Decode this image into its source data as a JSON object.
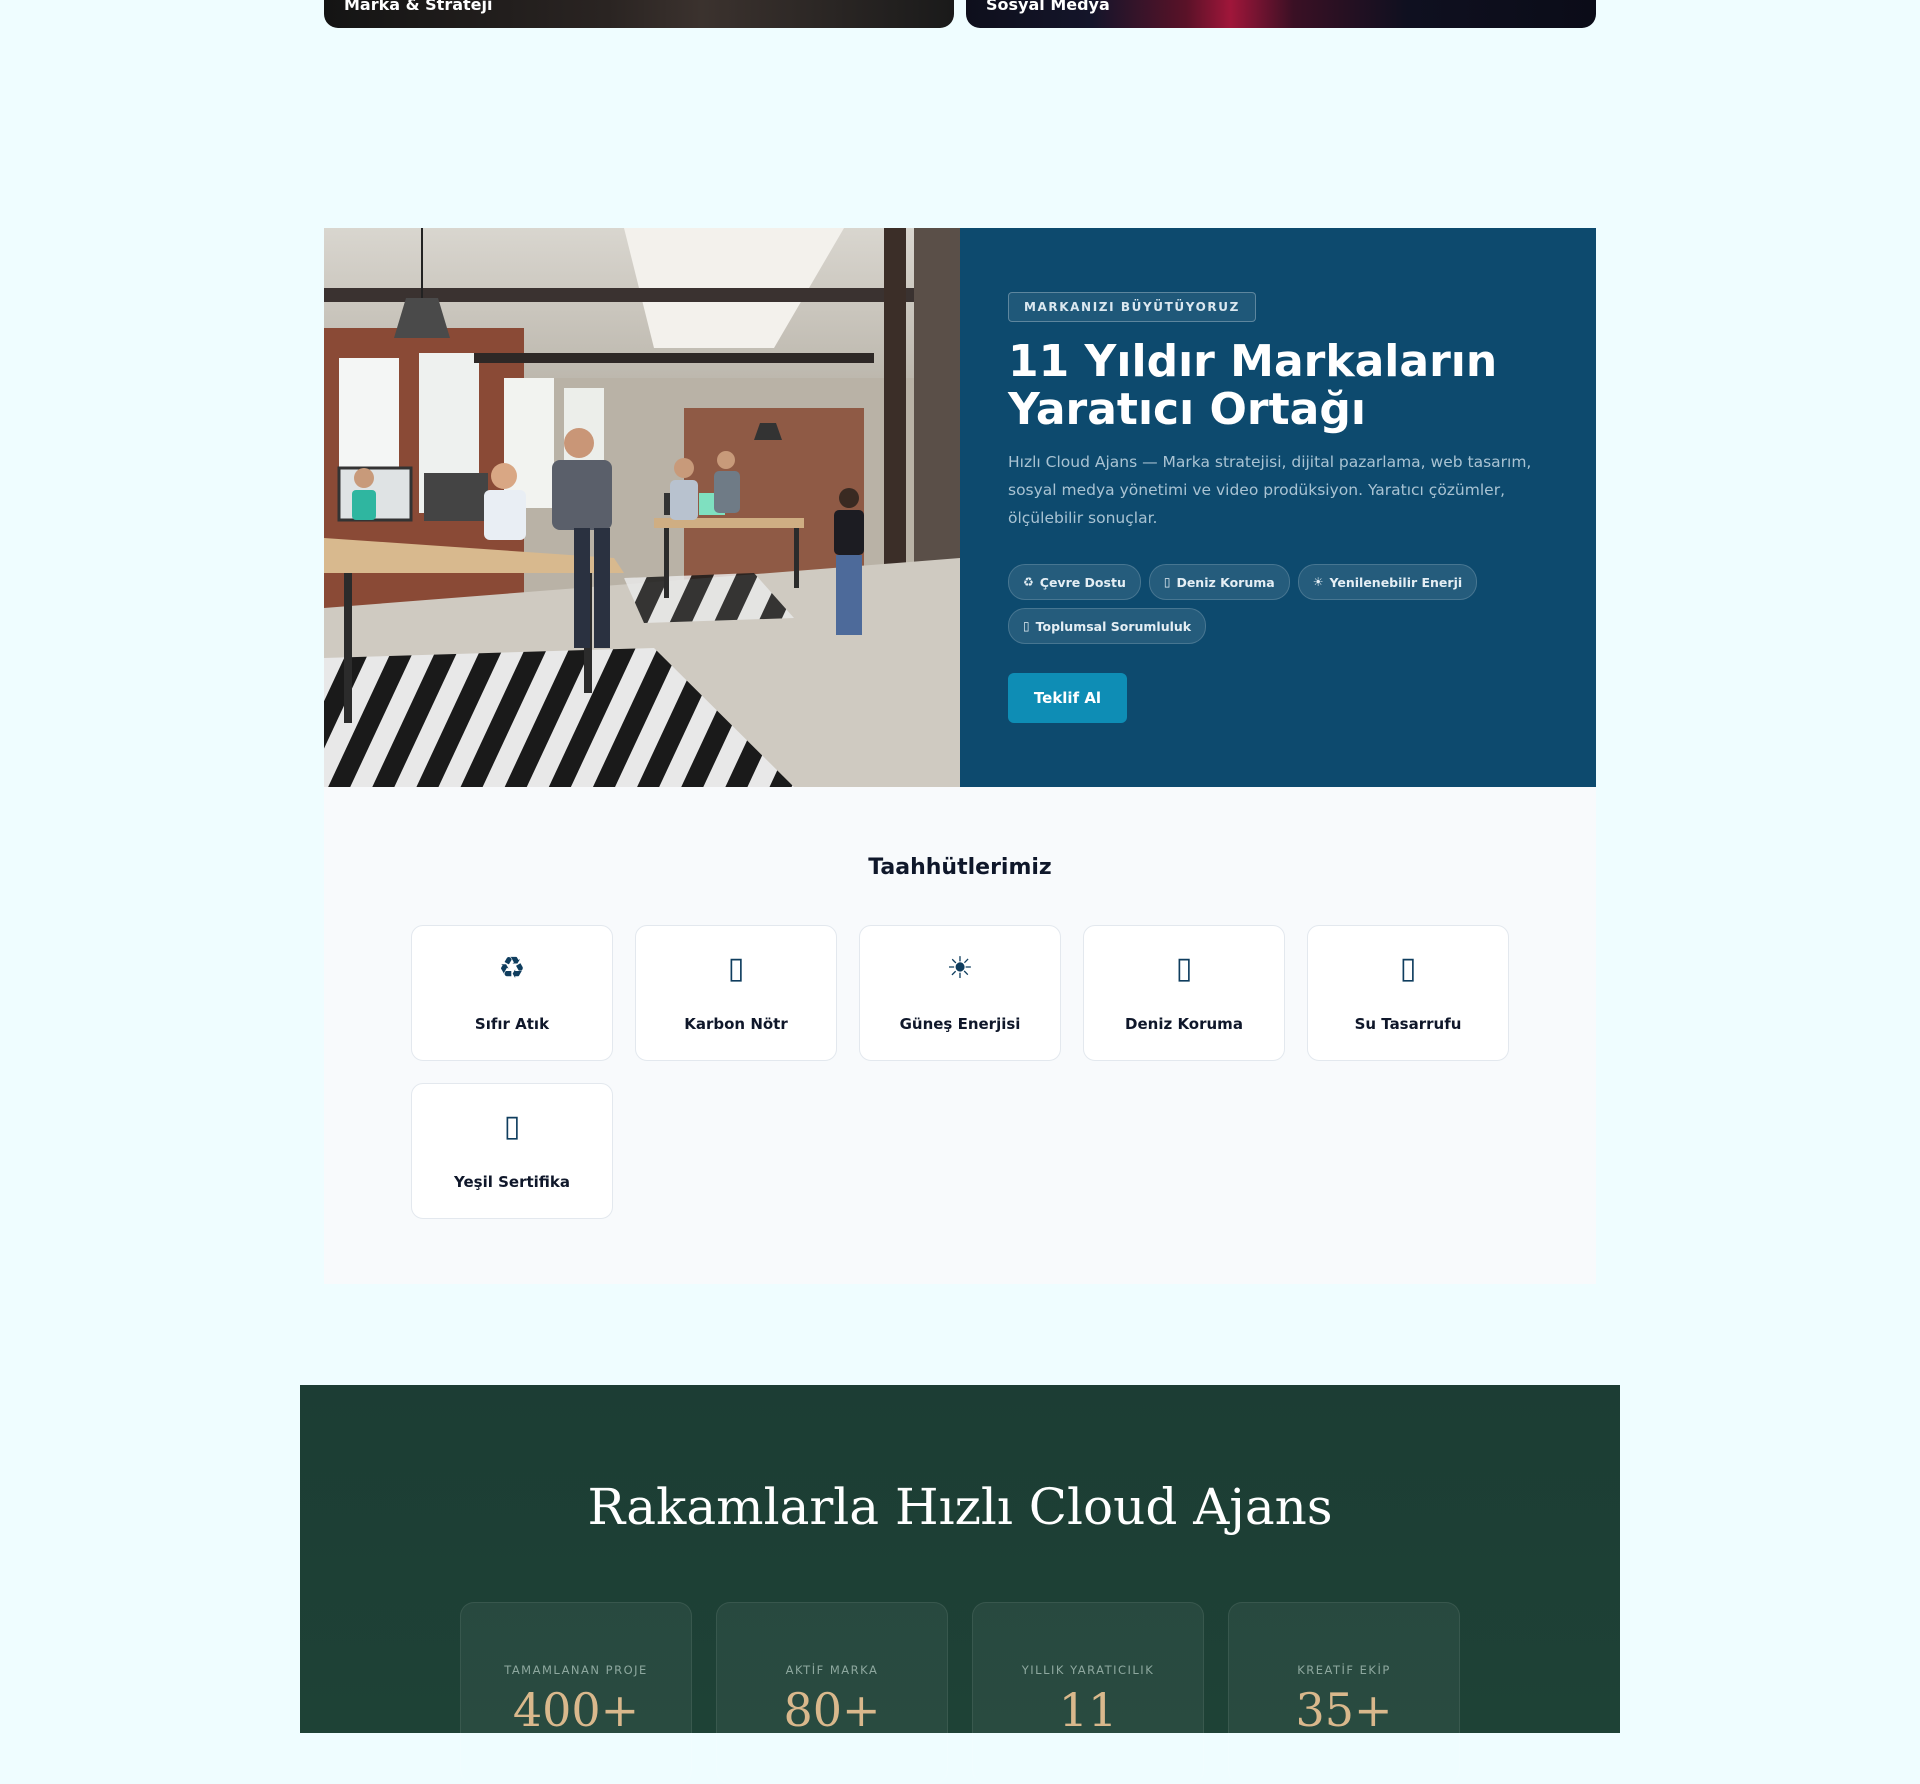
{
  "top_cards": {
    "left_label": "Marka & Strateji",
    "right_label": "Sosyal Medya"
  },
  "hero": {
    "eyebrow": "MARKANIZI BÜYÜTÜYORUZ",
    "title": "11 Yıldır Markaların Yaratıcı Ortağı",
    "description": "Hızlı Cloud Ajans — Marka stratejisi, dijital pazarlama, web tasarım, sosyal medya yönetimi ve video prodüksiyon. Yaratıcı çözümler, ölçülebilir sonuçlar.",
    "chips": [
      {
        "icon": "recycle-icon",
        "glyph": "♻",
        "label": "Çevre Dostu"
      },
      {
        "icon": "wave-icon",
        "glyph": "▯",
        "label": "Deniz Koruma"
      },
      {
        "icon": "sun-icon",
        "glyph": "☀",
        "label": "Yenilenebilir Enerji"
      },
      {
        "icon": "handshake-icon",
        "glyph": "▯",
        "label": "Toplumsal Sorumluluk"
      }
    ],
    "cta_label": "Teklif Al"
  },
  "commitments": {
    "title": "Taahhütlerimiz",
    "items": [
      {
        "icon": "recycle-icon",
        "glyph": "♻",
        "label": "Sıfır Atık"
      },
      {
        "icon": "leaf-icon",
        "glyph": "▯",
        "label": "Karbon Nötr"
      },
      {
        "icon": "sun-icon",
        "glyph": "☀",
        "label": "Güneş Enerjisi"
      },
      {
        "icon": "wave-icon",
        "glyph": "▯",
        "label": "Deniz Koruma"
      },
      {
        "icon": "droplet-icon",
        "glyph": "▯",
        "label": "Su Tasarrufu"
      },
      {
        "icon": "certificate-icon",
        "glyph": "▯",
        "label": "Yeşil Sertifika"
      }
    ]
  },
  "stats": {
    "title": "Rakamlarla Hızlı Cloud Ajans",
    "items": [
      {
        "label": "TAMAMLANAN PROJE",
        "value": "400+"
      },
      {
        "label": "AKTİF MARKA",
        "value": "80+"
      },
      {
        "label": "YILLIK YARATICILIK",
        "value": "11"
      },
      {
        "label": "KREATİF EKİP",
        "value": "35+"
      }
    ]
  },
  "colors": {
    "page_bg": "#effdff",
    "hero_panel": "#0d4a6e",
    "cta": "#0e8db5",
    "stats_bg": "#1c3d34",
    "stats_value": "#d9b88c"
  }
}
